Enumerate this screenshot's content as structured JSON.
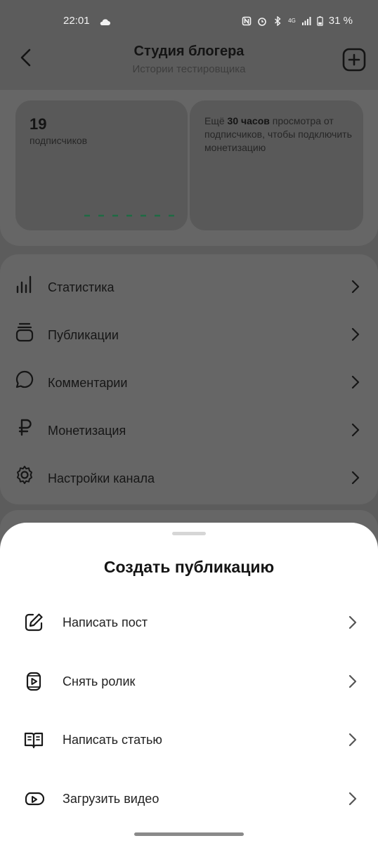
{
  "status_bar": {
    "time": "22:01",
    "battery": "31 %",
    "network": "4G"
  },
  "header": {
    "title": "Студия блогера",
    "subtitle": "Истории тестировщика"
  },
  "stats_card": {
    "count": "19",
    "label": "подписчиков"
  },
  "monetization_card": {
    "prefix": "Ещё ",
    "highlight": "30 часов",
    "rest": " просмотра от подписчиков, чтобы подключить монетизацию"
  },
  "menu": {
    "items": [
      {
        "label": "Статистика",
        "icon": "bar-chart-icon"
      },
      {
        "label": "Публикации",
        "icon": "stack-icon"
      },
      {
        "label": "Комментарии",
        "icon": "comment-icon"
      },
      {
        "label": "Монетизация",
        "icon": "ruble-icon"
      },
      {
        "label": "Настройки канала",
        "icon": "gear-icon"
      }
    ]
  },
  "sheet": {
    "title": "Создать публикацию",
    "items": [
      {
        "label": "Написать пост",
        "icon": "edit-icon"
      },
      {
        "label": "Снять ролик",
        "icon": "clip-icon"
      },
      {
        "label": "Написать статью",
        "icon": "book-icon"
      },
      {
        "label": "Загрузить видео",
        "icon": "video-icon"
      }
    ]
  },
  "colors": {
    "accent_dashes": "#1f6b44",
    "overlay": "#5c5c5c",
    "sheet": "#ffffff"
  }
}
